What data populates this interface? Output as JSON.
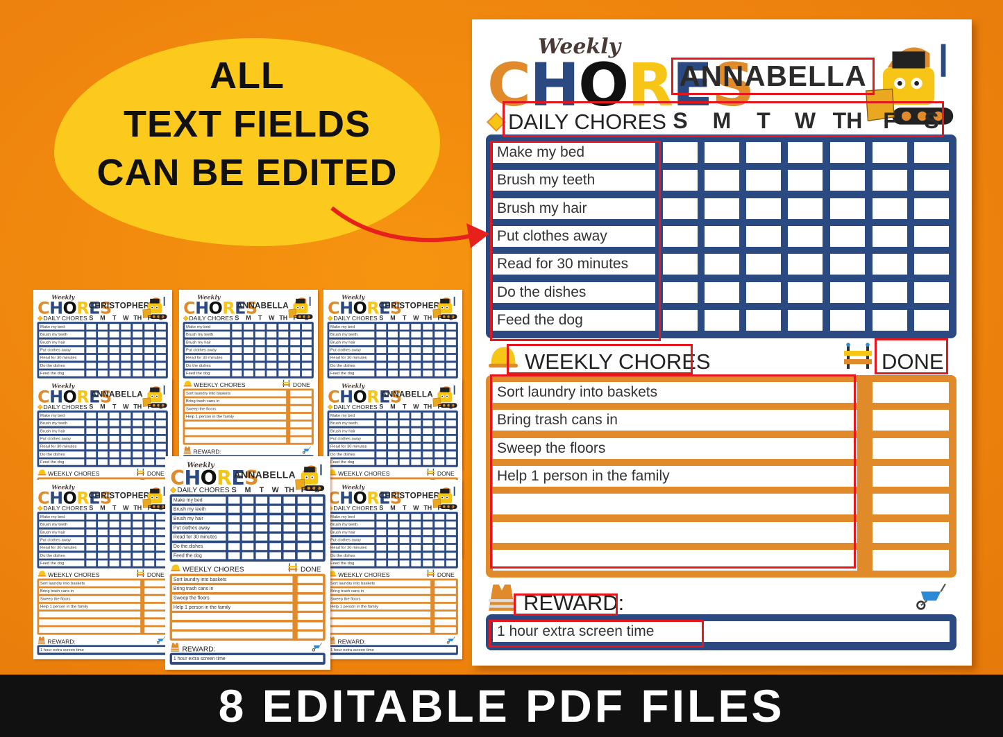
{
  "promo": {
    "bubble_lines": [
      "ALL",
      "TEXT FIELDS",
      "CAN BE EDITED"
    ],
    "bottom_banner": "8 EDITABLE PDF FILES"
  },
  "sheet": {
    "title_script": "Weekly",
    "title_logo": "CHORES",
    "daily_header": "DAILY CHORES",
    "days": [
      "S",
      "M",
      "T",
      "W",
      "TH",
      "F",
      "S"
    ],
    "daily_chores": [
      "Make my bed",
      "Brush my teeth",
      "Brush my hair",
      "Put clothes away",
      "Read for 30 minutes",
      "Do the dishes",
      "Feed the dog"
    ],
    "weekly_header": "WEEKLY CHORES",
    "done_label": "DONE",
    "weekly_chores": [
      "Sort laundry into baskets",
      "Bring trash cans in",
      "Sweep the floors",
      "Help 1 person in the family",
      "",
      "",
      ""
    ],
    "reward_label": "REWARD:",
    "reward_value": "1 hour extra screen time"
  },
  "main_sheet": {
    "name": "ANNABELLA",
    "vehicle": "bulldozer-icon"
  },
  "thumbnails": [
    {
      "name": "CHRISTOPHER",
      "vehicle": "bulldozer-icon"
    },
    {
      "name": "ANNABELLA",
      "vehicle": "cement-mixer-icon"
    },
    {
      "name": "CHRISTOPHER",
      "vehicle": "crane-icon"
    },
    {
      "name": "ANNABELLA",
      "vehicle": "dump-truck-icon"
    },
    {
      "name": "ANNABELLA",
      "vehicle": "crane-icon"
    },
    {
      "name": "CHRISTOPHER",
      "vehicle": "excavator-icon"
    },
    {
      "name": "CHRISTOPHER",
      "vehicle": "roller-icon"
    },
    {
      "name": "ANNABELLA",
      "vehicle": "bulldozer-icon"
    }
  ],
  "colors": {
    "background": "#f0870f",
    "bubble": "#fcca1c",
    "daily_grid": "#2c4a82",
    "weekly_grid": "#e08a2a",
    "edit_highlight": "#e5171d",
    "banner": "#111111"
  }
}
